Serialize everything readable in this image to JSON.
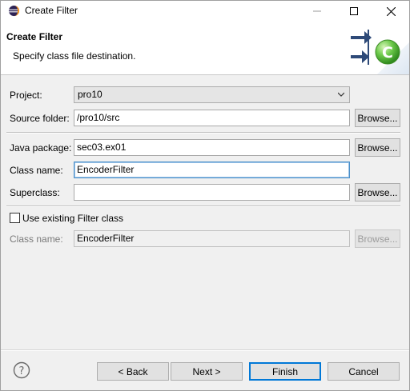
{
  "window": {
    "title": "Create Filter",
    "controls": [
      "minimize-icon",
      "maximize-icon",
      "close-icon"
    ]
  },
  "banner": {
    "title": "Create Filter",
    "description": "Specify class file destination."
  },
  "form": {
    "project_label": "Project:",
    "project_value": "pro10",
    "source_folder_label": "Source folder:",
    "source_folder_value": "/pro10/src",
    "java_package_label": "Java package:",
    "java_package_value": "sec03.ex01",
    "class_name_label": "Class name:",
    "class_name_value": "EncoderFilter",
    "superclass_label": "Superclass:",
    "superclass_value": "",
    "use_existing_label": "Use existing Filter class",
    "use_existing_checked": false,
    "existing_class_label": "Class name:",
    "existing_class_value": "EncoderFilter",
    "browse_label": "Browse..."
  },
  "footer": {
    "back_label": "< Back",
    "next_label": "Next >",
    "finish_label": "Finish",
    "cancel_label": "Cancel"
  },
  "colors": {
    "focus_border": "#4b8fc9",
    "default_button_border": "#0078d7",
    "icon_green": "#5bbf3a",
    "icon_navy": "#2e4a78"
  }
}
